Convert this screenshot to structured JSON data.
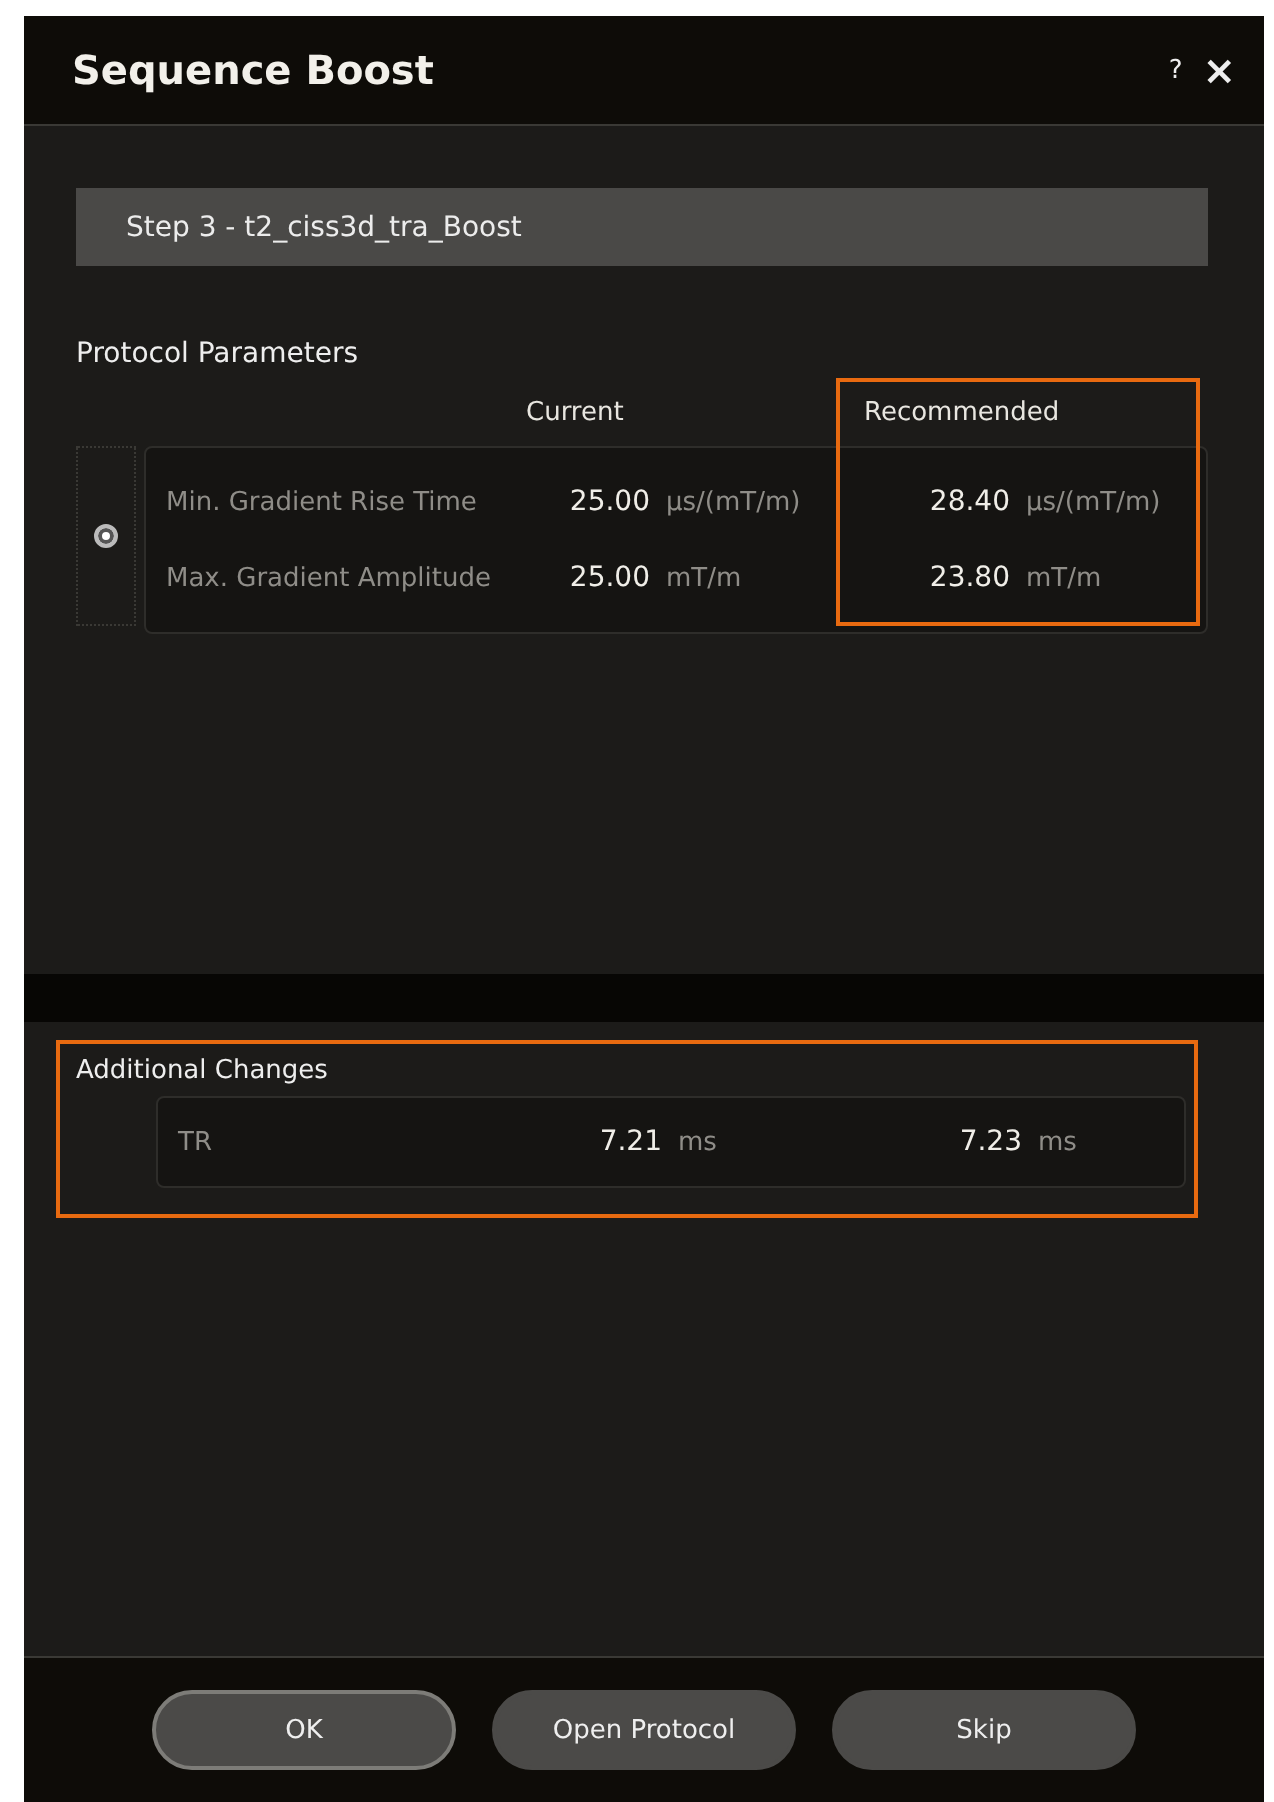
{
  "window": {
    "title": "Sequence Boost",
    "help": "?",
    "close": "×"
  },
  "step": "Step 3 - t2_ciss3d_tra_Boost",
  "protocol": {
    "title": "Protocol Parameters",
    "selected": true,
    "columns": [
      {
        "label": "Current"
      },
      {
        "label": "Recommended"
      }
    ],
    "recommended_highlighted": true,
    "rows": [
      {
        "name": "Min. Gradient Rise Time",
        "current": "25.00",
        "current_unit": "µs/(mT/m)",
        "recommended": "28.40",
        "recommended_unit": "µs/(mT/m)"
      },
      {
        "name": "Max. Gradient Amplitude",
        "current": "25.00",
        "current_unit": "mT/m",
        "recommended": "23.80",
        "recommended_unit": "mT/m"
      }
    ]
  },
  "additional": {
    "title": "Additional Changes",
    "highlighted": true,
    "rows": [
      {
        "name": "TR",
        "current": "7.21",
        "current_unit": "ms",
        "recommended": "7.23",
        "recommended_unit": "ms"
      }
    ]
  },
  "buttons": [
    {
      "label": "OK",
      "default": true
    },
    {
      "label": "Open Protocol",
      "default": false
    },
    {
      "label": "Skip",
      "default": false
    }
  ]
}
